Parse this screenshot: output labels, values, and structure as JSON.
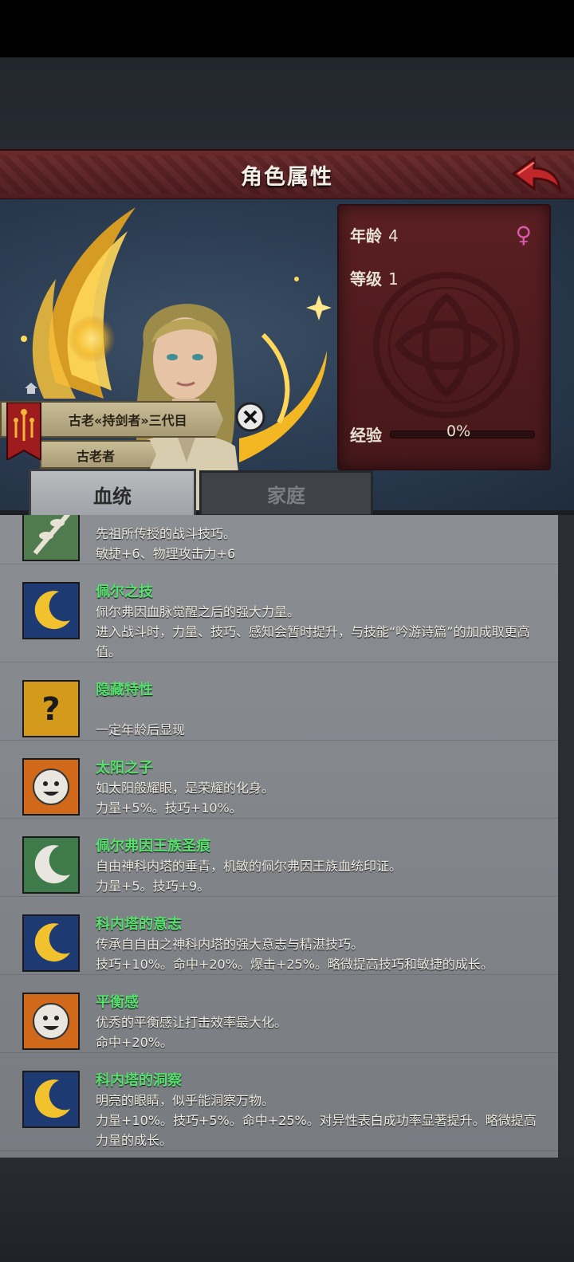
{
  "header": {
    "title": "角色属性"
  },
  "info": {
    "age_label": "年龄",
    "age_value": "4",
    "level_label": "等级",
    "level_value": "1",
    "gender_icon": "female-icon",
    "gender_color": "#d85aa8",
    "exp_label": "经验",
    "exp_value": "0%",
    "exp_progress": 0
  },
  "titles": {
    "primary": "古老«持剑者»三代目",
    "secondary": "古老者"
  },
  "tabs": [
    {
      "label": "血统",
      "active": true
    },
    {
      "label": "家庭",
      "active": false
    }
  ],
  "traits": [
    {
      "icon": "branch-icon",
      "title": "",
      "desc": [
        "先祖所传授的战斗技巧。",
        "敏捷+6、物理攻击力+6"
      ]
    },
    {
      "icon": "moon-icon",
      "title": "佩尔之技",
      "desc": [
        "佩尔弗因血脉觉醒之后的强大力量。",
        "进入战斗时，力量、技巧、感知会暂时提升，与技能“吟游诗篇”的加成取更高值。"
      ]
    },
    {
      "icon": "question-icon",
      "title": "隐藏特性",
      "desc": [
        "",
        "一定年龄后显现"
      ]
    },
    {
      "icon": "sun-face-icon",
      "title": "太阳之子",
      "desc": [
        "如太阳般耀眼，是荣耀的化身。",
        "力量+5%。技巧+10%。"
      ]
    },
    {
      "icon": "white-moon-icon",
      "title": "佩尔弗因王族圣痕",
      "desc": [
        "自由神科内塔的垂青，机敏的佩尔弗因王族血统印证。",
        "力量+5。技巧+9。"
      ]
    },
    {
      "icon": "moon-icon",
      "title": "科内塔的意志",
      "desc": [
        "传承自自由之神科内塔的强大意志与精湛技巧。",
        "技巧+10%。命中+20%。爆击+25%。略微提高技巧和敏捷的成长。"
      ]
    },
    {
      "icon": "sun-face-icon",
      "title": "平衡感",
      "desc": [
        "优秀的平衡感让打击效率最大化。",
        "命中+20%。"
      ]
    },
    {
      "icon": "moon-icon",
      "title": "科内塔的洞察",
      "desc": [
        "明亮的眼睛，似乎能洞察万物。",
        "力量+10%。技巧+5%。命中+25%。对异性表白成功率显著提升。略微提高力量的成长。"
      ]
    }
  ]
}
